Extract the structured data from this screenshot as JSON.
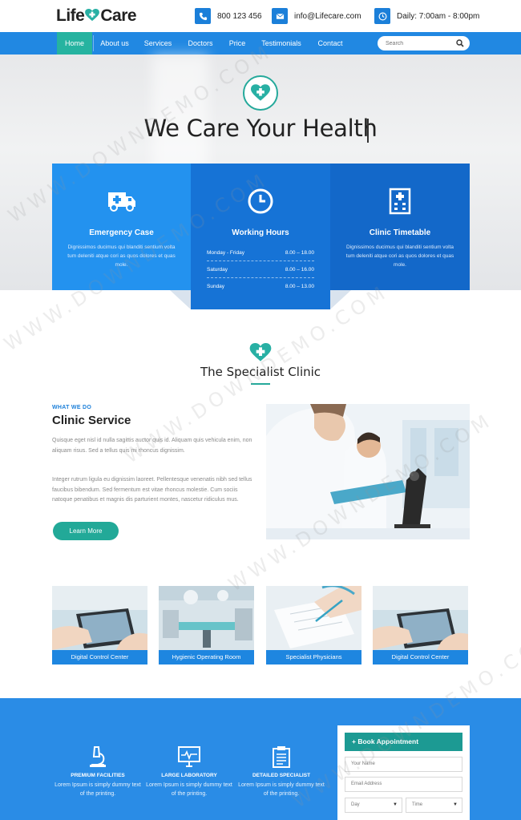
{
  "brand": {
    "name_left": "Life",
    "name_right": "Care"
  },
  "contacts": [
    {
      "icon": "phone-icon",
      "text": "800 123 456"
    },
    {
      "icon": "mail-icon",
      "text": "info@Lifecare.com"
    },
    {
      "icon": "clock-icon",
      "text": "Daily: 7:00am - 8:00pm"
    }
  ],
  "nav": {
    "items": [
      "Home",
      "About us",
      "Services",
      "Doctors",
      "Price",
      "Testimonials",
      "Contact"
    ],
    "active": "Home",
    "search_placeholder": "Search"
  },
  "hero": {
    "title": "We Care Your Health"
  },
  "boxes": {
    "emergency": {
      "title": "Emergency Case",
      "text": "Dignissimos ducimus qui blanditi sentium volta tum deleniti atque cori as quos dolores et quas mole."
    },
    "hours": {
      "title": "Working Hours",
      "rows": [
        {
          "day": "Monday - Friday",
          "time": "8.00 – 18.00"
        },
        {
          "day": "Saturday",
          "time": "8.00 – 16.00"
        },
        {
          "day": "Sunday",
          "time": "8.00 – 13.00"
        }
      ]
    },
    "timetable": {
      "title": "Clinic Timetable",
      "text": "Dignissimos ducimus qui blanditi sentium volta tum deleniti atque cori as quos dolores et quas mole."
    }
  },
  "specialist": {
    "title": "The Specialist Clinic"
  },
  "service": {
    "eyebrow": "WHAT WE DO",
    "title": "Clinic Service",
    "para1": "Quisque eget nisl id nulla sagittis auctor quis id. Aliquam quis vehicula enim, non aliquam risus. Sed a tellus quis mi rhoncus dignissim.",
    "para2": "Integer rutrum ligula eu dignissim laoreet. Pellentesque venenatis nibh sed tellus faucibus bibendum. Sed fermentum est vitae rhoncus molestie. Cum sociis natoque penatibus et magnis dis parturient montes, nascetur ridiculus mus.",
    "button": "Learn More"
  },
  "gallery": [
    {
      "caption": "Digital Control Center"
    },
    {
      "caption": "Hygienic Operating Room"
    },
    {
      "caption": "Specialist Physicians"
    },
    {
      "caption": "Digital Control Center"
    }
  ],
  "features": [
    {
      "icon": "microscope-icon",
      "title": "PREMIUM FACILITIES",
      "text": "Lorem Ipsum is simply dummy text of the printing."
    },
    {
      "icon": "monitor-heart-icon",
      "title": "LARGE LABORATORY",
      "text": "Lorem Ipsum is simply dummy text of the printing."
    },
    {
      "icon": "clipboard-icon",
      "title": "DETAILED SPECIALIST",
      "text": "Lorem Ipsum is simply dummy text of the printing."
    }
  ],
  "appointment": {
    "title": "+ Book Appointment",
    "name_placeholder": "Your Name",
    "email_placeholder": "Email Address",
    "day_value": "Day",
    "time_value": "Time"
  },
  "watermark": "WWW.DOWNDEMO.COM",
  "colors": {
    "primary": "#2188e2",
    "teal": "#26b3a0",
    "dark_blue": "#1368c9"
  }
}
